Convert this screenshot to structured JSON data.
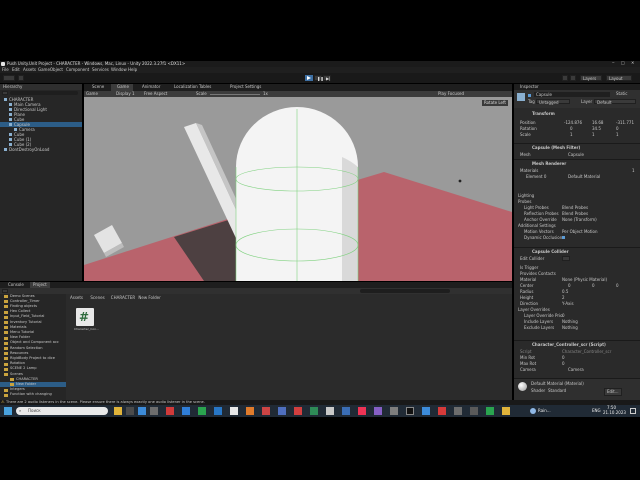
{
  "window": {
    "title": "Push Unity.Unit Project - CHARACTER - Windows, Mac, Linux - Unity 2022.3.27f1 <DX11>"
  },
  "menu": [
    "File",
    "Edit",
    "Assets",
    "GameObject",
    "Component",
    "Services",
    "Window",
    "Help"
  ],
  "toolbar": {
    "layers_label": "Layers",
    "layout_label": "Layout"
  },
  "hierarchy": {
    "tab_label": "Hierarchy",
    "items": [
      {
        "label": "CHARACTER",
        "depth": 0,
        "selected": false
      },
      {
        "label": "Main Camera",
        "depth": 1,
        "selected": false
      },
      {
        "label": "Directional Light",
        "depth": 1,
        "selected": false
      },
      {
        "label": "Plane",
        "depth": 1,
        "selected": false
      },
      {
        "label": "Cube",
        "depth": 1,
        "selected": false
      },
      {
        "label": "Capsule",
        "depth": 1,
        "selected": true
      },
      {
        "label": "Camera",
        "depth": 2,
        "selected": false
      },
      {
        "label": "Cube",
        "depth": 1,
        "selected": false
      },
      {
        "label": "Cube (1)",
        "depth": 1,
        "selected": false
      },
      {
        "label": "Cube (2)",
        "depth": 1,
        "selected": false
      },
      {
        "label": "DontDestroyOnLoad",
        "depth": 0,
        "selected": false
      }
    ]
  },
  "center_tabs": [
    {
      "label": "Scene",
      "active": false
    },
    {
      "label": "Game",
      "active": true
    },
    {
      "label": "Animator",
      "active": false
    },
    {
      "label": "Localization Tables",
      "active": false
    },
    {
      "label": "Project Settings",
      "active": false
    }
  ],
  "game_toolbar": {
    "display_mode": "Game",
    "display": "Display 1",
    "aspect": "Free Aspect",
    "scale_label": "Scale",
    "scale_value": "1x",
    "play_focused": "Play Focused",
    "stats": "Stats",
    "gizmos": "Gizmos"
  },
  "viewport": {
    "overlay_label": "Rotate Left",
    "sky_color": "#9a9a9a",
    "floor_color": "#b9636c"
  },
  "bottom_tabs": [
    {
      "label": "Console",
      "active": false
    },
    {
      "label": "Project",
      "active": true
    }
  ],
  "project": {
    "breadcrumb": [
      "Assets",
      "Scenes",
      "CHARACTER",
      "New Folder"
    ],
    "tree": [
      "Demo Scenes",
      "Controller_Timer",
      "Finding objects",
      "Hex Collect",
      "Input_Field_Tutorial",
      "Inventory Tutorial",
      "Materials",
      "Menu Tutorial",
      "New Folder",
      "Object and Component acc",
      "Random Selection",
      "Resources",
      "RigidBody Project to dice",
      "Rotation",
      "SCENE 2 Lamp",
      "Scenes",
      "CHARACTER",
      "New Folder",
      "Integers",
      "Function with changing"
    ],
    "asset_label": "Character_Con..."
  },
  "inspector": {
    "tab_label": "Inspector",
    "object_name": "Capsule",
    "static_label": "Static",
    "tag_label": "Tag",
    "tag_value": "Untagged",
    "layer_label": "Layer",
    "layer_value": "Default",
    "transform": {
      "header": "Transform",
      "position_label": "Position",
      "rotation_label": "Rotation",
      "scale_label": "Scale",
      "position": [
        "-124.876",
        "16.68",
        "-311.771"
      ],
      "rotation": [
        "0",
        "34.5",
        "0"
      ],
      "scale": [
        "1",
        "1",
        "1"
      ]
    },
    "mesh_filter": {
      "header": "Capsule (Mesh Filter)",
      "mesh_label": "Mesh",
      "mesh_value": "Capsule"
    },
    "mesh_renderer": {
      "header": "Mesh Renderer",
      "materials_label": "Materials",
      "materials_count": "1",
      "element0_label": "Element 0",
      "element0_value": "Default Material",
      "lighting_label": "Lighting",
      "probes_label": "Probes",
      "light_probes_label": "Light Probes",
      "light_probes_value": "Blend Probes",
      "reflection_probes_label": "Reflection Probes",
      "reflection_probes_value": "Blend Probes",
      "anchor_override_label": "Anchor Override",
      "anchor_override_value": "None (Transform)",
      "additional_label": "Additional Settings",
      "motion_vectors_label": "Motion Vectors",
      "motion_vectors_value": "Per Object Motion",
      "dynamic_occlusion_label": "Dynamic Occlusion"
    },
    "capsule_collider": {
      "header": "Capsule Collider",
      "edit_collider_label": "Edit Collider",
      "is_trigger_label": "Is Trigger",
      "provides_contacts_label": "Provides Contacts",
      "material_label": "Material",
      "material_value": "None (Physic Material)",
      "center_label": "Center",
      "center": [
        "0",
        "0",
        "0"
      ],
      "radius_label": "Radius",
      "radius_value": "0.5",
      "height_label": "Height",
      "height_value": "2",
      "direction_label": "Direction",
      "direction_value": "Y-Axis",
      "layer_overrides_label": "Layer Overrides",
      "layer_override_priority_label": "Layer Override Prio",
      "layer_override_priority_value": "0",
      "include_layers_label": "Include Layers",
      "include_layers_value": "Nothing",
      "exclude_layers_label": "Exclude Layers",
      "exclude_layers_value": "Nothing"
    },
    "script": {
      "header": "Character_Controller_scr (Script)",
      "script_label": "Script",
      "script_value": "Character_Controller_scr",
      "min_rot_label": "Min Rot",
      "min_rot_value": "0",
      "max_rot_label": "Max Rot",
      "max_rot_value": "0",
      "camera_label": "Camera",
      "camera_value": "Camera"
    },
    "material_preview": {
      "name": "Default Material (Material)",
      "shader_label": "Shader",
      "shader_value": "Standard",
      "edit_label": "Edit..."
    }
  },
  "status_bar": {
    "message": "There are 2 audio listeners in the scene. Please ensure there is always exactly one audio listener in the scene."
  },
  "taskbar": {
    "search_placeholder": "Поиск",
    "weather": "Rain...",
    "language": "ENG",
    "time": "7:50",
    "date": "21.10.2023"
  }
}
